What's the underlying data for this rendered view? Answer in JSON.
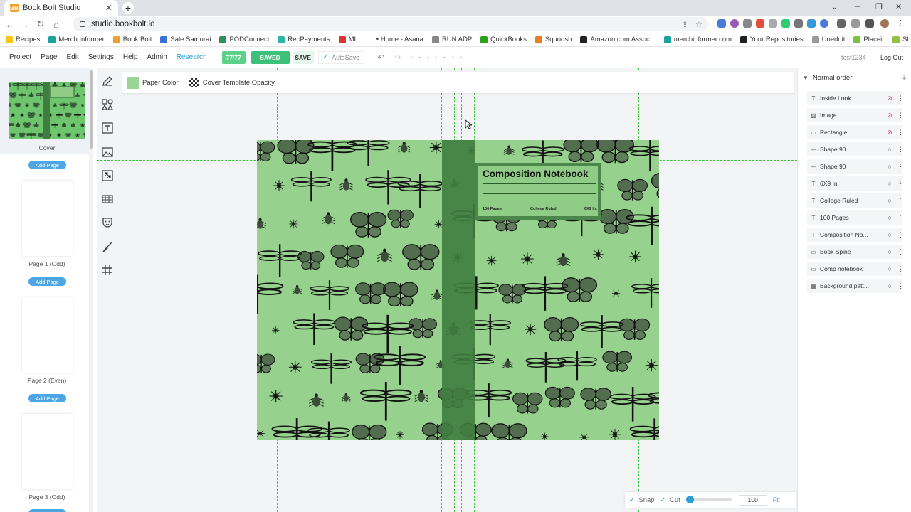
{
  "browser": {
    "tab_title": "Book Bolt Studio",
    "tab_favicon": "BB",
    "tab_close": "✕",
    "new_tab": "+",
    "url": "studio.bookbolt.io",
    "bookmarks": [
      {
        "label": "Recipes",
        "color": "#f5c518"
      },
      {
        "label": "Merch Informer",
        "color": "#1aa39c"
      },
      {
        "label": "Book Bolt",
        "color": "#f0a030"
      },
      {
        "label": "Sale Samurai",
        "color": "#3a6fd8"
      },
      {
        "label": "PODConnect",
        "color": "#2f8f5a"
      },
      {
        "label": "RecPayments",
        "color": "#2fb5a4"
      },
      {
        "label": "ML",
        "color": "#d33"
      },
      {
        "label": "• Home - Asana",
        "color": "#ffffff"
      },
      {
        "label": "RUN ADP",
        "color": "#888"
      },
      {
        "label": "QuickBooks",
        "color": "#2ca01c"
      },
      {
        "label": "Squoosh",
        "color": "#e67e22"
      },
      {
        "label": "Amazon.com Assoc...",
        "color": "#222"
      },
      {
        "label": "merchinformer.com",
        "color": "#1aa39c"
      },
      {
        "label": "Your Repositories",
        "color": "#222"
      },
      {
        "label": "Uneddit",
        "color": "#999"
      },
      {
        "label": "Placeit",
        "color": "#7cc242"
      },
      {
        "label": "Shopify",
        "color": "#95bf47"
      }
    ]
  },
  "menu": {
    "items": [
      "Project",
      "Page",
      "Edit",
      "Settings",
      "Help",
      "Admin",
      "Research"
    ],
    "counter": "77/77",
    "saved": "SAVED",
    "save": "SAVE",
    "autosave": "AutoSave",
    "user": "test1234",
    "logout": "Log Out"
  },
  "pages": {
    "cover_label": "Cover",
    "add_page": "Add Page",
    "page1": "Page 1 (Odd)",
    "page2": "Page 2 (Even)",
    "page3": "Page 3 (Odd)"
  },
  "toolbar": {
    "paper_color": "Paper Color",
    "cover_opacity": "Cover Template Opacity"
  },
  "cover": {
    "title": "Composition Notebook",
    "pages": "100 Pages",
    "ruling": "College Ruled",
    "size": "6X9 In."
  },
  "zoom": {
    "snap": "Snap",
    "cut": "Cut",
    "value": "100",
    "fit": "Fit",
    "slider_fraction": 0.05
  },
  "layers": {
    "header": "Normal order",
    "items": [
      {
        "icon": "T",
        "name": "Inside Look",
        "hidden": true
      },
      {
        "icon": "▨",
        "name": "Image",
        "hidden": true
      },
      {
        "icon": "▭",
        "name": "Rectangle",
        "hidden": true
      },
      {
        "icon": "—",
        "name": "Shape 90",
        "hidden": false
      },
      {
        "icon": "—",
        "name": "Shape 90",
        "hidden": false
      },
      {
        "icon": "T",
        "name": "6X9 In.",
        "hidden": false
      },
      {
        "icon": "T",
        "name": "College Ruled",
        "hidden": false
      },
      {
        "icon": "T",
        "name": "100 Pages",
        "hidden": false
      },
      {
        "icon": "T",
        "name": "Composition No...",
        "hidden": false
      },
      {
        "icon": "▭",
        "name": "Book Spine",
        "hidden": false
      },
      {
        "icon": "▭",
        "name": "Comp notebook",
        "hidden": false
      },
      {
        "icon": "▦",
        "name": "Background patt...",
        "hidden": false
      }
    ]
  },
  "colors": {
    "accent": "#2a9fd6",
    "saved_green": "#3cc17a",
    "counter_green": "#5bd18a",
    "cover_green": "#96d28d",
    "spine_green": "#3f7d3f"
  }
}
